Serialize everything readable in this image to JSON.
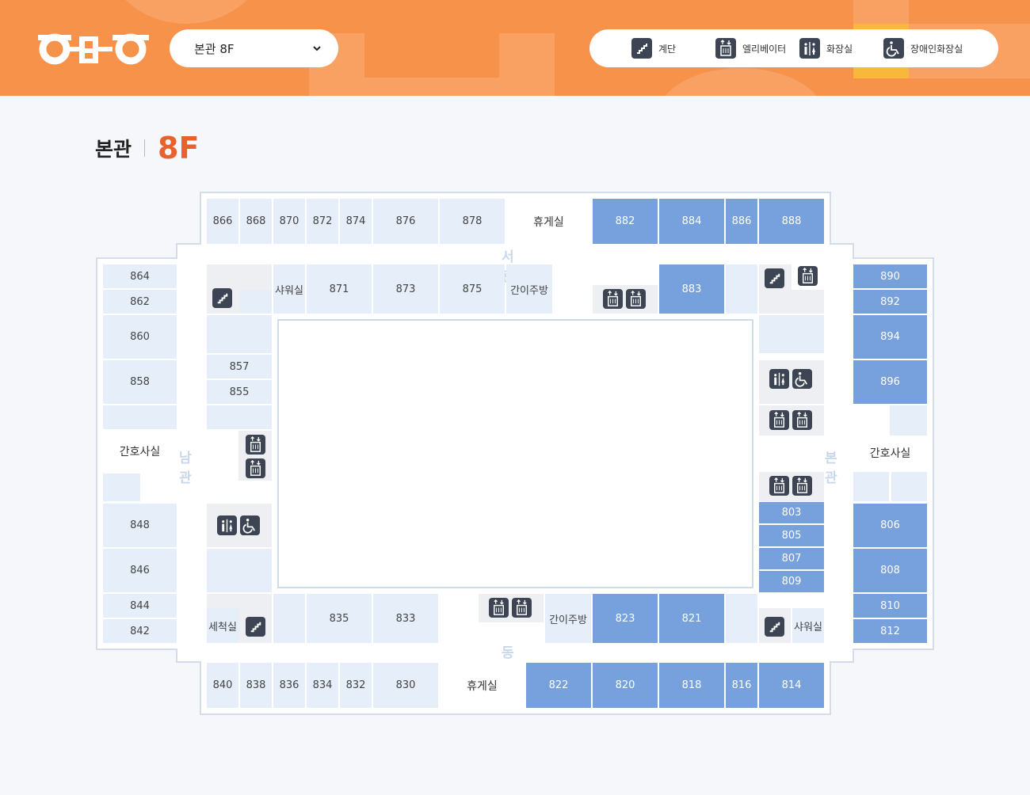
{
  "header": {
    "logo_text": "오디오",
    "floor_select": {
      "value": "본관 8F"
    },
    "legend": [
      {
        "icon": "stairs-icon",
        "label": "계단"
      },
      {
        "icon": "elevator-icon",
        "label": "엘리베이터"
      },
      {
        "icon": "restroom-icon",
        "label": "화장실"
      },
      {
        "icon": "accessible-restroom-icon",
        "label": "장애인화장실"
      }
    ]
  },
  "page": {
    "building": "본관",
    "floor": "8F"
  },
  "colors": {
    "header_bg": "#f7924a",
    "accent": "#e9612b",
    "room_light": "#e6eefa",
    "room_dark": "#76a1dc",
    "icon_bg": "#3d4554"
  },
  "wings": {
    "west": "서관",
    "south": "남관",
    "main": "본관",
    "east": "동관"
  },
  "rooms": {
    "r866": "866",
    "r868": "868",
    "r870": "870",
    "r872": "872",
    "r874": "874",
    "r876": "876",
    "r878": "878",
    "lounge_top": "휴게실",
    "r882": "882",
    "r884": "884",
    "r886": "886",
    "r888": "888",
    "r864": "864",
    "r862": "862",
    "r860": "860",
    "r858": "858",
    "nurse_left": "간호사실",
    "r848": "848",
    "r846": "846",
    "r844": "844",
    "r842": "842",
    "shower_top": "샤워실",
    "r871": "871",
    "r873": "873",
    "r875": "875",
    "kitchen_top": "간이주방",
    "r883": "883",
    "r857": "857",
    "r855": "855",
    "r890": "890",
    "r892": "892",
    "r894": "894",
    "r896": "896",
    "nurse_right": "간호사실",
    "r803": "803",
    "r805": "805",
    "r807": "807",
    "r809": "809",
    "r806": "806",
    "r808": "808",
    "r810": "810",
    "r812": "812",
    "wash": "세척실",
    "r835": "835",
    "r833": "833",
    "kitchen_bottom": "간이주방",
    "r823": "823",
    "r821": "821",
    "shower_bottom": "샤워실",
    "r840": "840",
    "r838": "838",
    "r836": "836",
    "r834": "834",
    "r832": "832",
    "r830": "830",
    "lounge_bottom": "휴게실",
    "r822": "822",
    "r820": "820",
    "r818": "818",
    "r816": "816",
    "r814": "814"
  }
}
